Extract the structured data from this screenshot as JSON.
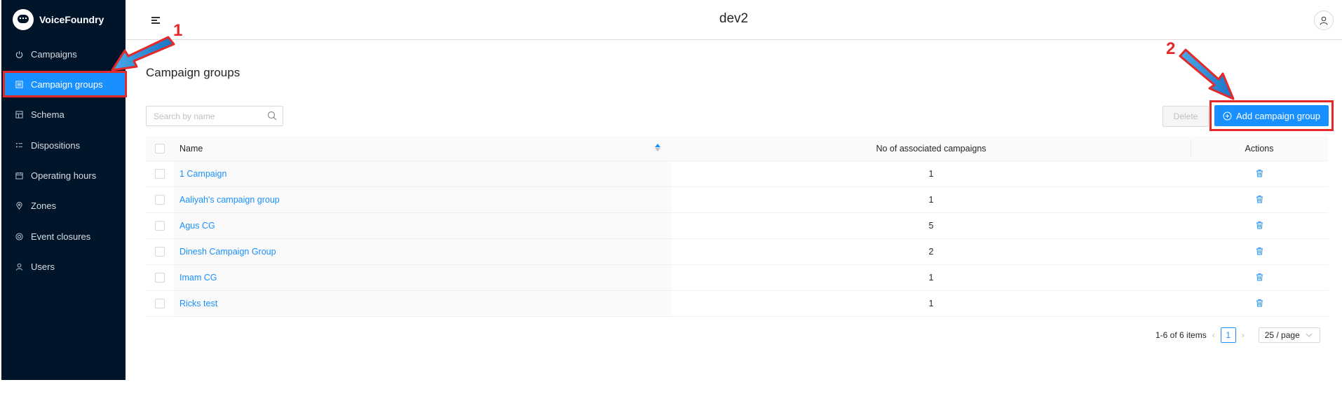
{
  "app": {
    "logo_text": "VoiceFoundry",
    "environment": "dev2"
  },
  "sidebar": {
    "items": [
      {
        "label": "Campaigns",
        "icon": "power-icon"
      },
      {
        "label": "Campaign groups",
        "icon": "group-icon",
        "active": true
      },
      {
        "label": "Schema",
        "icon": "schema-icon"
      },
      {
        "label": "Dispositions",
        "icon": "list-icon"
      },
      {
        "label": "Operating hours",
        "icon": "calendar-icon"
      },
      {
        "label": "Zones",
        "icon": "location-icon"
      },
      {
        "label": "Event closures",
        "icon": "target-icon"
      },
      {
        "label": "Users",
        "icon": "user-icon"
      }
    ]
  },
  "main": {
    "title": "Campaign groups",
    "search_placeholder": "Search by name",
    "delete_label": "Delete",
    "add_label": "Add campaign group"
  },
  "table": {
    "columns": [
      "Name",
      "No of associated campaigns",
      "Actions"
    ],
    "rows": [
      {
        "name": "1 Campaign",
        "count": "1"
      },
      {
        "name": "Aaliyah's campaign group",
        "count": "1"
      },
      {
        "name": "Agus CG",
        "count": "5"
      },
      {
        "name": "Dinesh Campaign Group",
        "count": "2"
      },
      {
        "name": "Imam CG",
        "count": "1"
      },
      {
        "name": "Ricks test",
        "count": "1"
      }
    ]
  },
  "pagination": {
    "summary": "1-6 of 6 items",
    "current_page": "1",
    "page_size": "25 / page"
  },
  "annotations": {
    "step1": "1",
    "step2": "2",
    "color": "#e52828"
  },
  "colors": {
    "sidebar_bg": "#001529",
    "primary": "#1890ff",
    "annotation": "#e52828"
  }
}
